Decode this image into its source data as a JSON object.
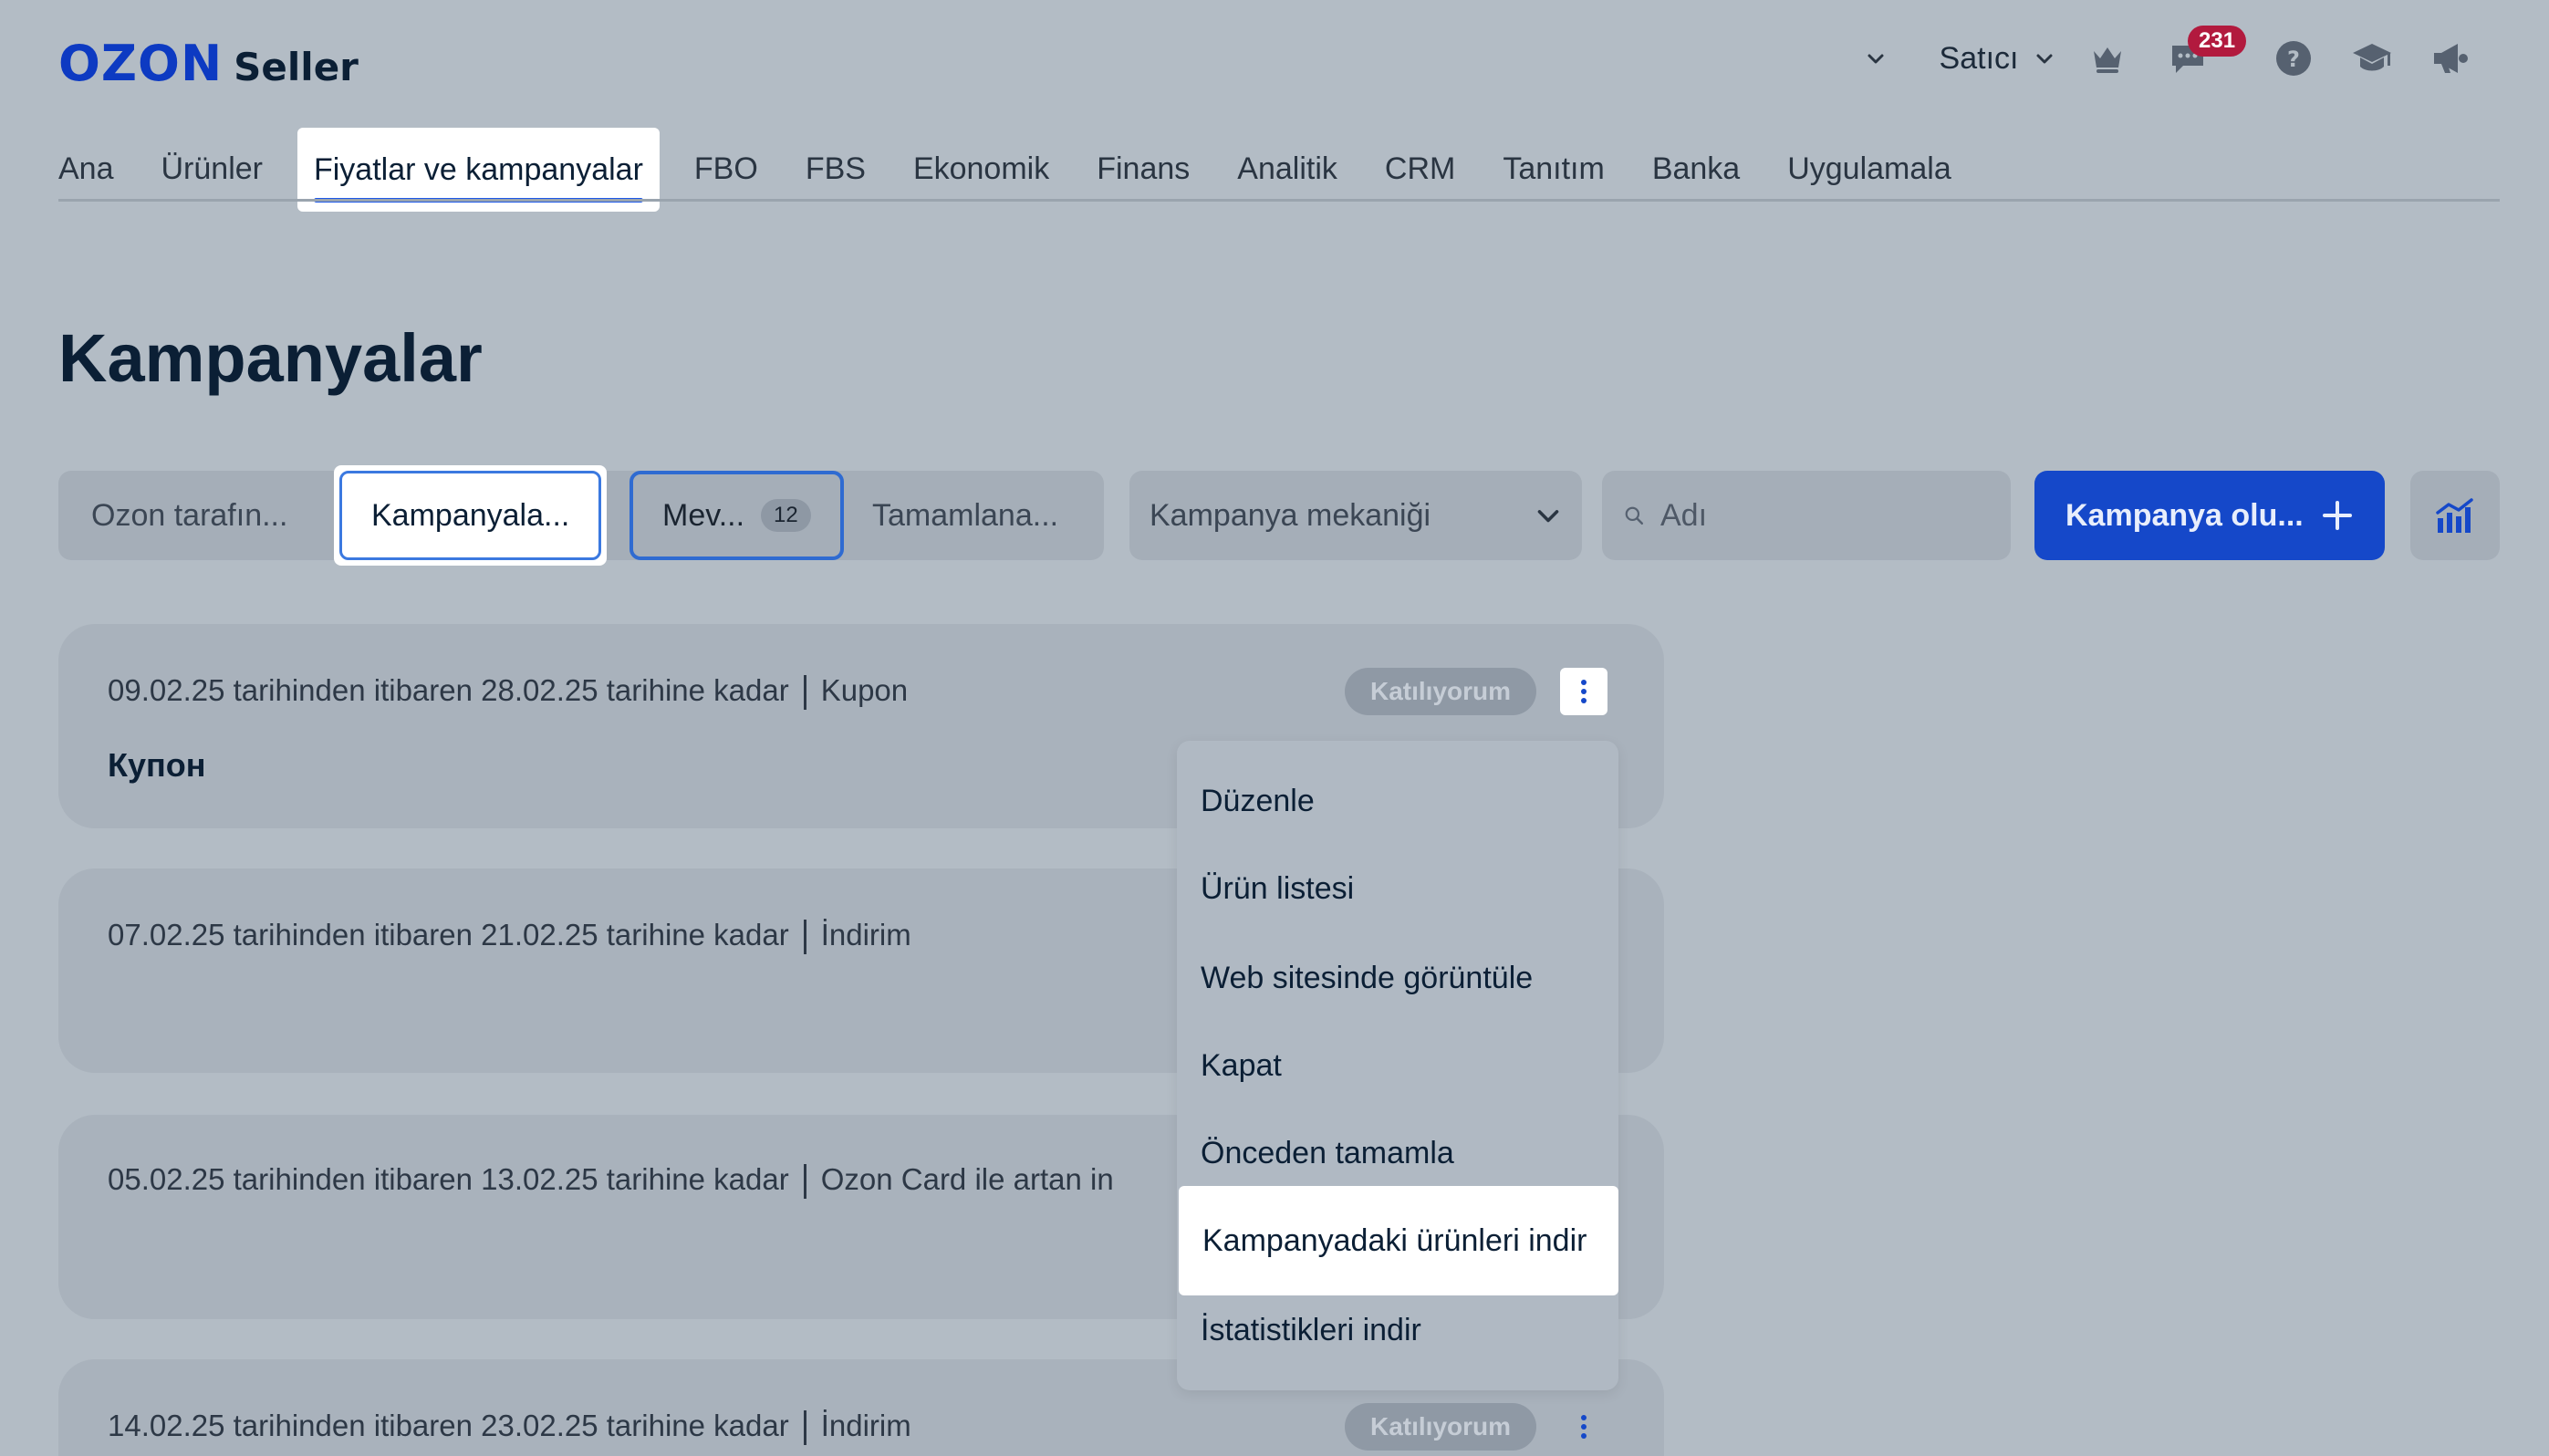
{
  "brand": {
    "logo_ozon": "OZON",
    "logo_seller": "Seller"
  },
  "topbar": {
    "seller_label": "Satıcı",
    "messages_count": "231"
  },
  "nav": {
    "tabs": [
      "Ana",
      "Ürünler",
      "Fiyatlar ve kampanyalar",
      "FBO",
      "FBS",
      "Ekonomik",
      "Finans",
      "Analitik",
      "CRM",
      "Tanıtım",
      "Banka",
      "Uygulamala"
    ]
  },
  "page": {
    "title": "Kampanyalar"
  },
  "filters": {
    "seg_ozon": "Ozon tarafın...",
    "seg_kampanyalar": "Kampanyala...",
    "seg_mevcut": "Mev...",
    "seg_mevcut_count": "12",
    "seg_tamamlanan": "Tamamlana...",
    "mechanic_select": "Kampanya mekaniği",
    "search_placeholder": "Adı",
    "create_button": "Kampanya olu..."
  },
  "campaigns": [
    {
      "meta": "09.02.25 tarihinden itibaren 28.02.25 tarihine kadar",
      "type": "Kupon",
      "name": "Купон",
      "status": "Katılıyorum"
    },
    {
      "meta": "07.02.25 tarihinden itibaren 21.02.25 tarihine kadar",
      "type": "İndirim",
      "name": "",
      "status": ""
    },
    {
      "meta": "05.02.25 tarihinden itibaren 13.02.25 tarihine kadar",
      "type": "Ozon Card ile artan in",
      "name": "",
      "status": ""
    },
    {
      "meta": "14.02.25 tarihinden itibaren 23.02.25 tarihine kadar",
      "type": "İndirim",
      "name": "",
      "status": "Katılıyorum"
    }
  ],
  "menu": {
    "items": [
      "Düzenle",
      "Ürün listesi",
      "Web sitesinde görüntüle",
      "Kapat",
      "Önceden tamamla",
      "Kampanyadaki ürünleri indir",
      "İstatistikleri indir"
    ]
  },
  "colors": {
    "accent": "#1548c9",
    "tab_underline": "#1d57e8",
    "badge": "#b21a3e",
    "overlay_bg": "#b3bcc5"
  }
}
